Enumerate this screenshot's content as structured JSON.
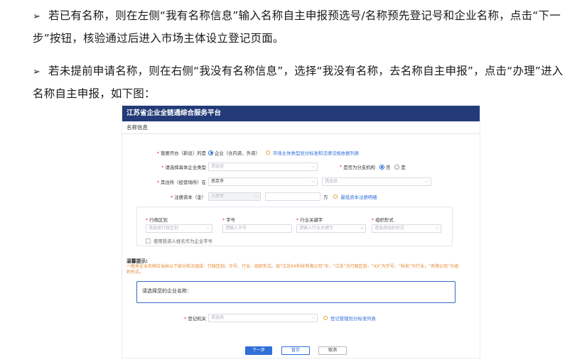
{
  "doc": {
    "bullet": "➢",
    "para1": "若已有名称，则在左侧“我有名称信息”输入名称自主申报预选号/名称预先登记号和企业名称，点击“下一步”按钮，核验通过后进入市场主体设立登记页面。",
    "para2": "若未提前申请名称，则在右侧“我没有名称信息”，选择“我没有名称，去名称自主申报”，点击“办理”进入名称自主申报，如下图："
  },
  "app": {
    "title": "江苏省企业全链通综合服务平台",
    "subtitle": "名称信息"
  },
  "form": {
    "q1": {
      "label": "我要开办（新设）的是",
      "option_selected": "企业（含内资、外资）",
      "link": "市场主体类型划分标准和法律法规依据列表"
    },
    "q2": {
      "label": "请选择具体企业类型",
      "placeholder": "请选择"
    },
    "q3": {
      "label": "是否为分支机构",
      "opt_no": "否",
      "opt_yes": "是"
    },
    "q4": {
      "label": "其住所（经营场所）在",
      "city": "南京市",
      "district_placeholder": "请选择",
      "town_placeholder": "请选择"
    },
    "q5": {
      "label": "注册资本（金）",
      "currency_placeholder": "人民币",
      "unit": "万",
      "link": "最低资本注册明细"
    },
    "name_parts": [
      {
        "label": "行政区划",
        "placeholder": "请选择行政区划"
      },
      {
        "label": "字号",
        "placeholder": "请输入字号"
      },
      {
        "label": "行业关键字",
        "placeholder": "请输入行业关键字"
      },
      {
        "label": "组织形式",
        "placeholder": "请选择组织形式"
      }
    ],
    "checkbox_label": "使用投资人姓名作为企业字号",
    "notice_title": "温馨提示:",
    "notice_text": "一般来企业名称应当由以下部分依次组成：行政区划、字号、行业、组织形式。如“江苏XX科技有限公司”中，“江苏”为行政区划，“XX”为字号，“科技”为行业，“有限公司”为组织形式。",
    "name_box_label": "请选择您的企业名称：",
    "registry": {
      "label": "登记机关",
      "placeholder": "请选择",
      "link": "登记管辖划分标准列表"
    }
  },
  "buttons": {
    "next": "下一步",
    "save": "暂存",
    "cancel": "取消"
  },
  "colors": {
    "header": "#233b78",
    "accent": "#2f6fd8",
    "required": "#e0322b",
    "notice": "#e6882c"
  }
}
